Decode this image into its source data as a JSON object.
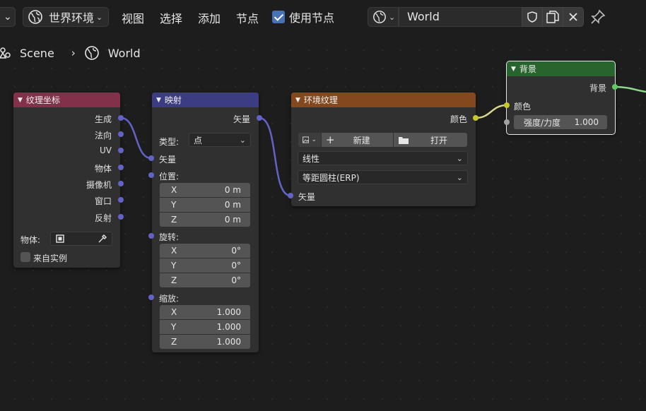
{
  "header": {
    "editor_type": "世界环境",
    "menus": [
      "视图",
      "选择",
      "添加",
      "节点"
    ],
    "use_nodes_label": "使用节点",
    "use_nodes_checked": true,
    "datablock_name": "World"
  },
  "breadcrumb": {
    "scene": "Scene",
    "world": "World"
  },
  "nodes": {
    "texcoord": {
      "title": "纹理坐标",
      "header_color": "#83314a",
      "outputs": [
        "生成",
        "法向",
        "UV",
        "物体",
        "摄像机",
        "窗口",
        "反射"
      ],
      "object_label": "物体:",
      "from_instancer_label": "来自实例"
    },
    "mapping": {
      "title": "映射",
      "header_color": "#3c3c83",
      "output": "矢量",
      "type_label": "类型:",
      "type_value": "点",
      "input_vector": "矢量",
      "location_label": "位置:",
      "location": [
        [
          "X",
          "0 m"
        ],
        [
          "Y",
          "0 m"
        ],
        [
          "Z",
          "0 m"
        ]
      ],
      "rotation_label": "旋转:",
      "rotation": [
        [
          "X",
          "0°"
        ],
        [
          "Y",
          "0°"
        ],
        [
          "Z",
          "0°"
        ]
      ],
      "scale_label": "缩放:",
      "scale": [
        [
          "X",
          "1.000"
        ],
        [
          "Y",
          "1.000"
        ],
        [
          "Z",
          "1.000"
        ]
      ]
    },
    "envtex": {
      "title": "环境纹理",
      "header_color": "#83481e",
      "output": "颜色",
      "new_label": "新建",
      "open_label": "打开",
      "interpolation": "线性",
      "projection": "等距圆柱(ERP)",
      "input_vector": "矢量"
    },
    "background": {
      "title": "背景",
      "header_color": "#27642e",
      "output": "背景",
      "color_input": "颜色",
      "strength_label": "强度/力度",
      "strength_value": "1.000"
    }
  },
  "colors": {
    "vector_socket": "#6363c7",
    "color_socket": "#c7c729",
    "shader_socket": "#63c763",
    "accent": "#4772b3"
  }
}
